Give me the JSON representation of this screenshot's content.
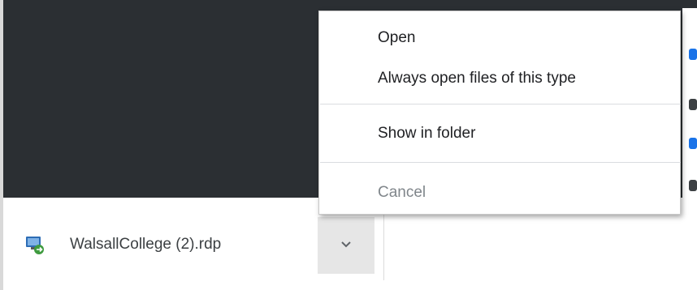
{
  "menu": {
    "items": [
      {
        "label": "Open",
        "enabled": true
      },
      {
        "label": "Always open files of this type",
        "enabled": true
      },
      {
        "label": "Show in folder",
        "enabled": true
      },
      {
        "label": "Cancel",
        "enabled": false
      }
    ]
  },
  "download": {
    "file_name": "WalsallCollege (2).rdp",
    "icon": "remote-desktop-file-icon",
    "dropdown_icon": "chevron-down-icon"
  },
  "colors": {
    "page_dark": "#2b2f33",
    "menu_bg": "#ffffff",
    "text": "#202124",
    "disabled_text": "#80868b",
    "accent": "#1a73e8"
  }
}
